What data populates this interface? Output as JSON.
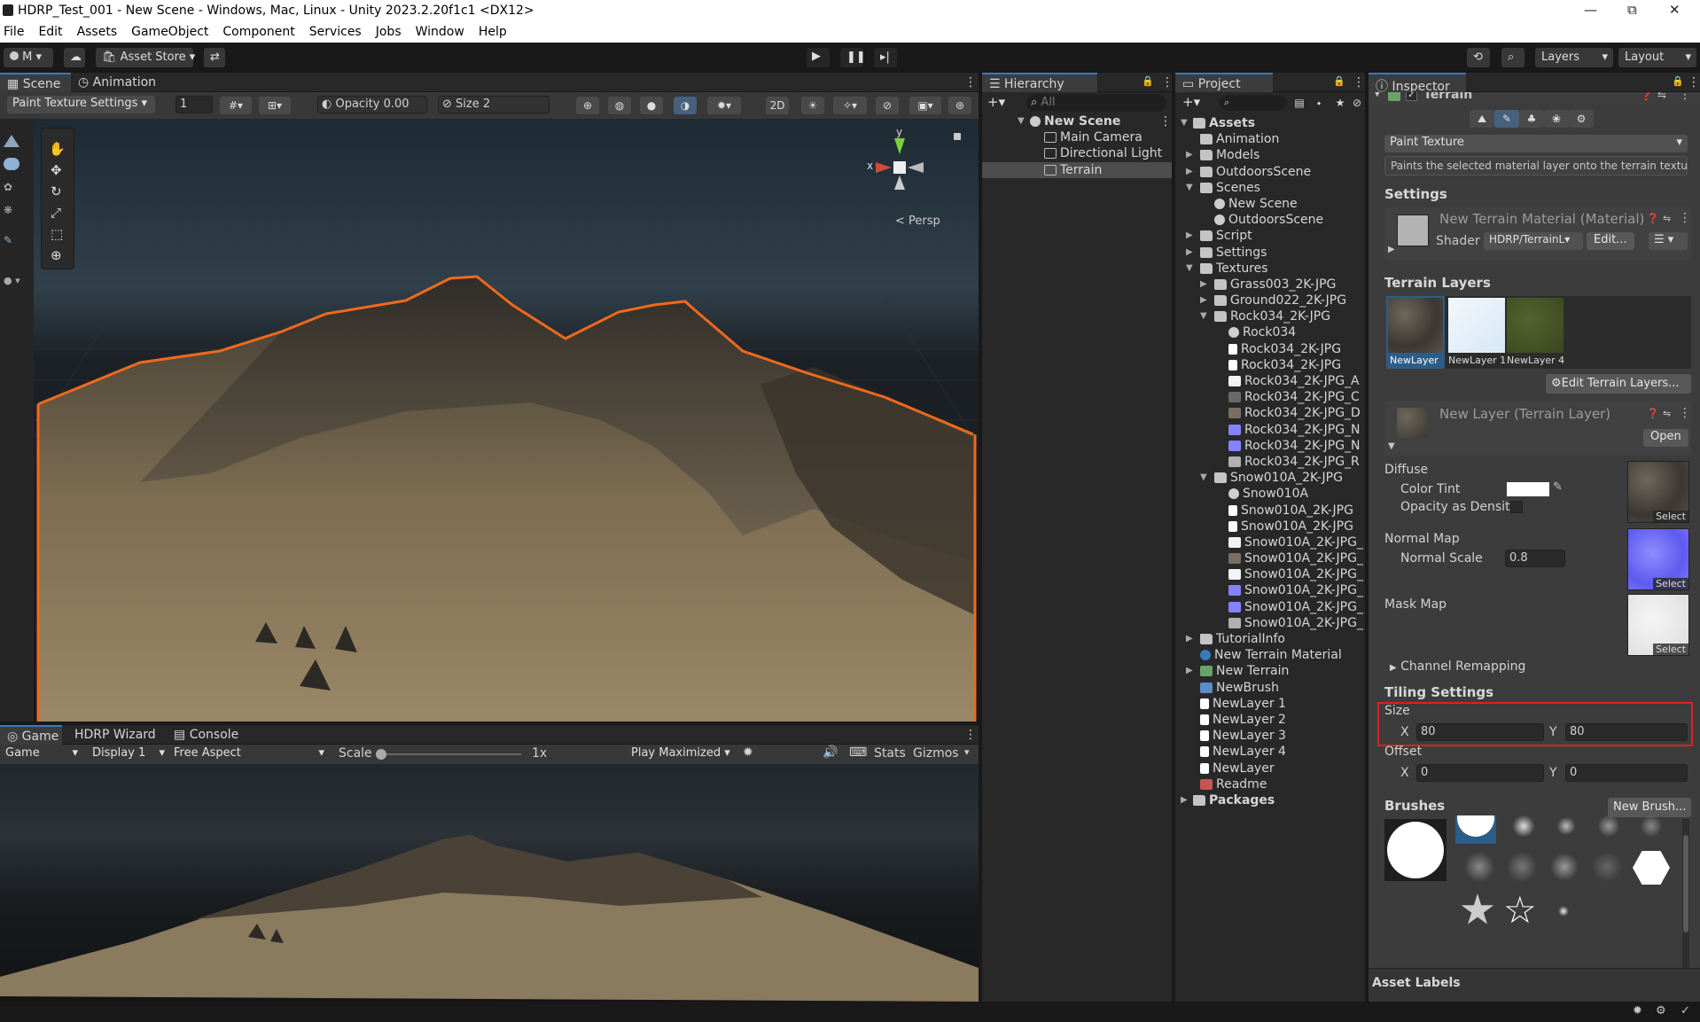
{
  "title": {
    "text": "HDRP_Test_001 - New Scene - Windows, Mac, Linux - Unity 2023.2.20f1c1 <DX12>",
    "min": "—",
    "max": "⧉",
    "close": "✕"
  },
  "menu": [
    "File",
    "Edit",
    "Assets",
    "GameObject",
    "Component",
    "Services",
    "Jobs",
    "Window",
    "Help"
  ],
  "toolbar": {
    "account": "M",
    "asset_store": "Asset Store",
    "layers": "Layers",
    "layout": "Layout"
  },
  "scene": {
    "tab_scene": "Scene",
    "tab_animation": "Animation",
    "paint_settings": "Paint Texture Settings",
    "brush_index": "1",
    "opacity": "Opacity 0.00",
    "size": "Size 2",
    "mode2d": "2D",
    "persp": "< Persp",
    "gizmo_x": "x",
    "gizmo_y": "y"
  },
  "game": {
    "tab_game": "Game",
    "tab_wizard": "HDRP Wizard",
    "tab_console": "Console",
    "game_dd": "Game",
    "display": "Display 1",
    "aspect": "Free Aspect",
    "scale_label": "Scale",
    "scale_value": "1x",
    "play_max": "Play Maximized",
    "stats": "Stats",
    "gizmos": "Gizmos"
  },
  "hierarchy": {
    "tab": "Hierarchy",
    "search": "All",
    "scene": "New Scene",
    "items": [
      "Main Camera",
      "Directional Light",
      "Terrain"
    ]
  },
  "project": {
    "tab": "Project",
    "root": "Assets",
    "items": [
      {
        "t": "Animation",
        "d": 1,
        "k": "folder",
        "a": ""
      },
      {
        "t": "Models",
        "d": 1,
        "k": "folder",
        "a": "r"
      },
      {
        "t": "OutdoorsScene",
        "d": 1,
        "k": "folder",
        "a": "r"
      },
      {
        "t": "Scenes",
        "d": 1,
        "k": "folder",
        "a": "d"
      },
      {
        "t": "New Scene",
        "d": 2,
        "k": "scene",
        "a": ""
      },
      {
        "t": "OutdoorsScene",
        "d": 2,
        "k": "scene",
        "a": ""
      },
      {
        "t": "Script",
        "d": 1,
        "k": "folder",
        "a": "r"
      },
      {
        "t": "Settings",
        "d": 1,
        "k": "folder",
        "a": "r"
      },
      {
        "t": "Textures",
        "d": 1,
        "k": "folder",
        "a": "d"
      },
      {
        "t": "Grass003_2K-JPG",
        "d": 2,
        "k": "folder",
        "a": "r"
      },
      {
        "t": "Ground022_2K-JPG",
        "d": 2,
        "k": "folder",
        "a": "r"
      },
      {
        "t": "Rock034_2K-JPG",
        "d": 2,
        "k": "folder",
        "a": "d"
      },
      {
        "t": "Rock034",
        "d": 3,
        "k": "sphere",
        "a": ""
      },
      {
        "t": "Rock034_2K-JPG",
        "d": 3,
        "k": "file",
        "a": ""
      },
      {
        "t": "Rock034_2K-JPG",
        "d": 3,
        "k": "file",
        "a": ""
      },
      {
        "t": "Rock034_2K-JPG_A",
        "d": 3,
        "k": "white",
        "a": ""
      },
      {
        "t": "Rock034_2K-JPG_C",
        "d": 3,
        "k": "dark",
        "a": ""
      },
      {
        "t": "Rock034_2K-JPG_D",
        "d": 3,
        "k": "rock",
        "a": ""
      },
      {
        "t": "Rock034_2K-JPG_N",
        "d": 3,
        "k": "normal",
        "a": ""
      },
      {
        "t": "Rock034_2K-JPG_N",
        "d": 3,
        "k": "normal",
        "a": ""
      },
      {
        "t": "Rock034_2K-JPG_R",
        "d": 3,
        "k": "grey",
        "a": ""
      },
      {
        "t": "Snow010A_2K-JPG",
        "d": 2,
        "k": "folder",
        "a": "d"
      },
      {
        "t": "Snow010A",
        "d": 3,
        "k": "sphere",
        "a": ""
      },
      {
        "t": "Snow010A_2K-JPG",
        "d": 3,
        "k": "file",
        "a": ""
      },
      {
        "t": "Snow010A_2K-JPG",
        "d": 3,
        "k": "file",
        "a": ""
      },
      {
        "t": "Snow010A_2K-JPG_",
        "d": 3,
        "k": "white",
        "a": ""
      },
      {
        "t": "Snow010A_2K-JPG_",
        "d": 3,
        "k": "rock",
        "a": ""
      },
      {
        "t": "Snow010A_2K-JPG_",
        "d": 3,
        "k": "white",
        "a": ""
      },
      {
        "t": "Snow010A_2K-JPG_",
        "d": 3,
        "k": "normal",
        "a": ""
      },
      {
        "t": "Snow010A_2K-JPG_",
        "d": 3,
        "k": "normal",
        "a": ""
      },
      {
        "t": "Snow010A_2K-JPG_",
        "d": 3,
        "k": "grey",
        "a": ""
      },
      {
        "t": "TutorialInfo",
        "d": 1,
        "k": "folder",
        "a": "r"
      },
      {
        "t": "New Terrain Material",
        "d": 1,
        "k": "mat",
        "a": ""
      },
      {
        "t": "New Terrain",
        "d": 1,
        "k": "terrain",
        "a": "r"
      },
      {
        "t": "NewBrush",
        "d": 1,
        "k": "brush",
        "a": ""
      },
      {
        "t": "NewLayer 1",
        "d": 1,
        "k": "file",
        "a": ""
      },
      {
        "t": "NewLayer 2",
        "d": 1,
        "k": "file",
        "a": ""
      },
      {
        "t": "NewLayer 3",
        "d": 1,
        "k": "file",
        "a": ""
      },
      {
        "t": "NewLayer 4",
        "d": 1,
        "k": "file",
        "a": ""
      },
      {
        "t": "NewLayer",
        "d": 1,
        "k": "file",
        "a": ""
      },
      {
        "t": "Readme",
        "d": 1,
        "k": "readme",
        "a": ""
      }
    ],
    "packages": "Packages"
  },
  "inspector": {
    "tab": "Inspector",
    "component": "Terrain",
    "tool_dd": "Paint Texture",
    "tool_desc": "Paints the selected material layer onto the terrain texture",
    "settings_h": "Settings",
    "material": "New Terrain Material (Material)",
    "shader_label": "Shader",
    "shader_value": "HDRP/TerrainL",
    "edit_btn": "Edit...",
    "layers_h": "Terrain Layers",
    "layers": [
      "NewLayer",
      "NewLayer 1",
      "NewLayer 4"
    ],
    "edit_layers": "Edit Terrain Layers...",
    "layer_title": "New Layer (Terrain Layer)",
    "open_btn": "Open",
    "diffuse": "Diffuse",
    "color_tint": "Color Tint",
    "opacity_density": "Opacity as Density",
    "normal_map": "Normal Map",
    "normal_scale_label": "Normal Scale",
    "normal_scale": "0.8",
    "mask_map": "Mask Map",
    "select": "Select",
    "channel": "Channel Remapping",
    "tiling_h": "Tiling Settings",
    "size_label": "Size",
    "size_x": "80",
    "size_y": "80",
    "offset_label": "Offset",
    "offset_x": "0",
    "offset_y": "0",
    "x": "X",
    "y": "Y",
    "brushes": "Brushes",
    "new_brush": "New Brush...",
    "asset_labels": "Asset Labels"
  },
  "colors": {
    "accent": "#3a79bb",
    "highlight": "#e02020",
    "selection": "#2c5d87"
  }
}
